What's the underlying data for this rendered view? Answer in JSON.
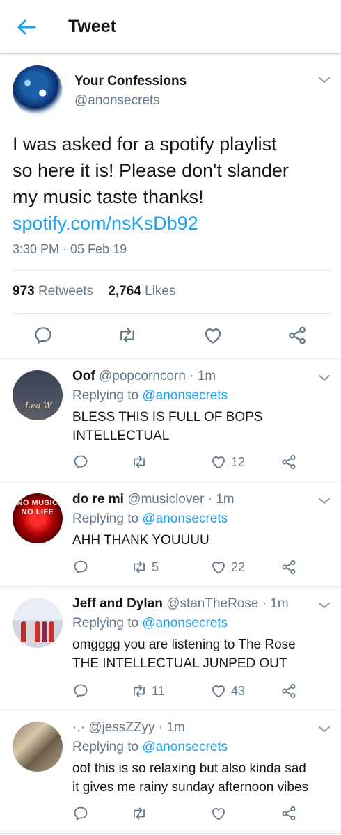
{
  "header": {
    "title": "Tweet"
  },
  "tweet": {
    "name": "Your Confessions",
    "handle": "@anonsecrets",
    "text_lines": [
      "I was asked for a spotify playlist",
      "so here it is! Please don't slander",
      "my music taste thanks!"
    ],
    "link": "spotify.com/nsKsDb92",
    "time": "3:30 PM · 05 Feb 19",
    "retweets_count": "973",
    "retweets_label": "Retweets",
    "likes_count": "2,764",
    "likes_label": "Likes"
  },
  "replies": [
    {
      "name": "Oof",
      "handle": "@popcorncorn",
      "dot": "·",
      "time": "1m",
      "replying_prefix": "Replying to",
      "replying_to": "@anonsecrets",
      "body_lines": [
        "BLESS THIS IS FULL OF BOPS",
        "INTELLECTUAL"
      ],
      "retweets": "",
      "likes": "12",
      "avatar_text": "Lea  W"
    },
    {
      "name": "do re mi",
      "handle": "@musiclover",
      "dot": "·",
      "time": "1m",
      "replying_prefix": "Replying to",
      "replying_to": "@anonsecrets",
      "body_lines": [
        "AHH THANK YOUUUU"
      ],
      "retweets": "5",
      "likes": "22",
      "avatar_text": "NO MUSIC NO LIFE"
    },
    {
      "name": "Jeff and Dylan",
      "handle": "@stanTheRose",
      "dot": "·",
      "time": "1m",
      "replying_prefix": "Replying to",
      "replying_to": "@anonsecrets",
      "body_lines": [
        "omgggg you are listening to The Rose",
        "THE INTELLECTUAL JUNPED OUT"
      ],
      "retweets": "11",
      "likes": "43"
    },
    {
      "name": "·.·",
      "handle": "@jessZZyy",
      "dot": "·",
      "time": "1m",
      "replying_prefix": "Replying to",
      "replying_to": "@anonsecrets",
      "body_lines": [
        "oof this is so relaxing but also kinda sad",
        "it gives me rainy sunday afternoon vibes"
      ],
      "retweets": "",
      "likes": ""
    }
  ],
  "colors": {
    "accent": "#1da1f2",
    "text": "#14171a",
    "muted": "#657786",
    "divider": "#e1e8ed"
  },
  "icons": [
    "back-arrow-icon",
    "reply-icon",
    "retweet-icon",
    "like-icon",
    "share-icon",
    "chevron-down-icon"
  ]
}
